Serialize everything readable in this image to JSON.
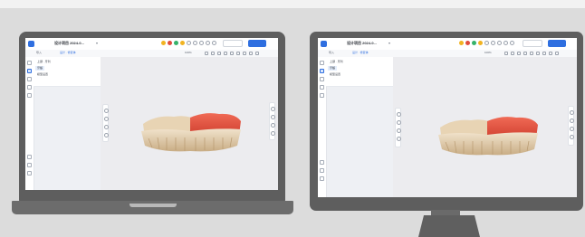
{
  "app": {
    "title": "设计项目 2024-0...",
    "colors": {
      "accent": "#2f6fe0",
      "gum": "#e2503f",
      "tooth": "#e9d7bb"
    },
    "status_dots": [
      "#f1b321",
      "#e04b3c",
      "#35b26a",
      "#f1b321"
    ],
    "tabs": [
      "导入",
      "设计 · 修复体"
    ],
    "zoom": "100%",
    "panel": {
      "items": [
        "上颌 · 牙列",
        "牙龈",
        "模型设置"
      ],
      "selected_index": 1
    },
    "canvas_object": "upper-jaw-3d-model"
  },
  "devices": [
    "laptop",
    "desktop-monitor"
  ]
}
